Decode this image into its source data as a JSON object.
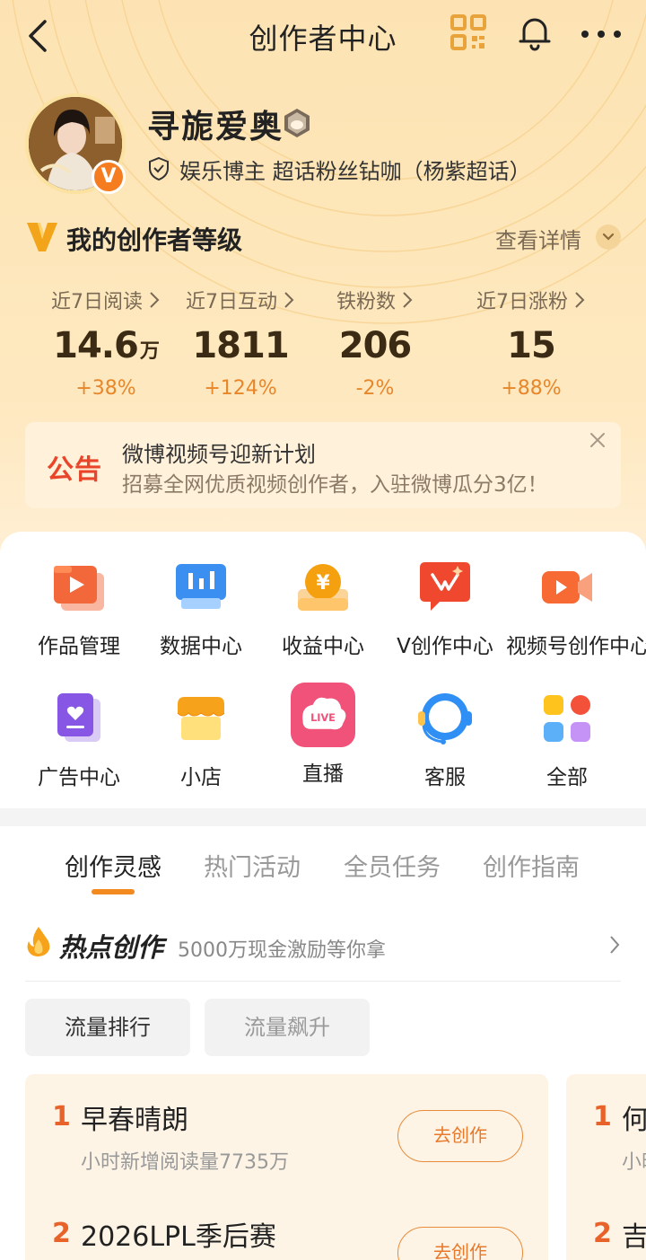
{
  "nav": {
    "title": "创作者中心"
  },
  "profile": {
    "name": "寻旎爱奥",
    "verify_text": "娱乐博主 超话粉丝钻咖（杨紫超话）",
    "vip_letter": "V"
  },
  "level": {
    "title": "我的创作者等级",
    "detail": "查看详情"
  },
  "stats": [
    {
      "label": "近7日阅读",
      "value": "14.6",
      "unit": "万",
      "delta": "+38%"
    },
    {
      "label": "近7日互动",
      "value": "1811",
      "unit": "",
      "delta": "+124%"
    },
    {
      "label": "铁粉数",
      "value": "206",
      "unit": "",
      "delta": "-2%"
    },
    {
      "label": "近7日涨粉",
      "value": "15",
      "unit": "",
      "delta": "+88%"
    }
  ],
  "notice": {
    "tag": "公告",
    "title": "微博视频号迎新计划",
    "sub": "招募全网优质视频创作者，入驻微博瓜分3亿！"
  },
  "grid": [
    {
      "label": "作品管理",
      "icon": "works-icon"
    },
    {
      "label": "数据中心",
      "icon": "data-icon"
    },
    {
      "label": "收益中心",
      "icon": "revenue-icon"
    },
    {
      "label": "V创作中心",
      "icon": "vcreate-icon"
    },
    {
      "label": "视频号创作中心",
      "icon": "video-icon"
    },
    {
      "label": "广告中心",
      "icon": "ad-icon"
    },
    {
      "label": "小店",
      "icon": "shop-icon"
    },
    {
      "label": "直播",
      "icon": "live-icon",
      "badge": "LIVE"
    },
    {
      "label": "客服",
      "icon": "service-icon"
    },
    {
      "label": "全部",
      "icon": "all-icon"
    }
  ],
  "tabs": [
    "创作灵感",
    "热门活动",
    "全员任务",
    "创作指南"
  ],
  "hot": {
    "title": "热点创作",
    "sub": "5000万现金激励等你拿"
  },
  "chips": [
    "流量排行",
    "流量飙升"
  ],
  "list1": [
    {
      "rank": "1",
      "title": "早春晴朗",
      "sub": "小时新增阅读量7735万",
      "btn": "去创作"
    },
    {
      "rank": "2",
      "title": "2026LPL季后赛",
      "sub": "",
      "btn": "去创作"
    }
  ],
  "list2": [
    {
      "rank": "1",
      "title": "何",
      "sub": "小时"
    },
    {
      "rank": "2",
      "title": "吉",
      "sub": ""
    }
  ],
  "colors": {
    "accent": "#f28a1f",
    "delta": "#e8862a",
    "notice_red": "#e8452a"
  }
}
